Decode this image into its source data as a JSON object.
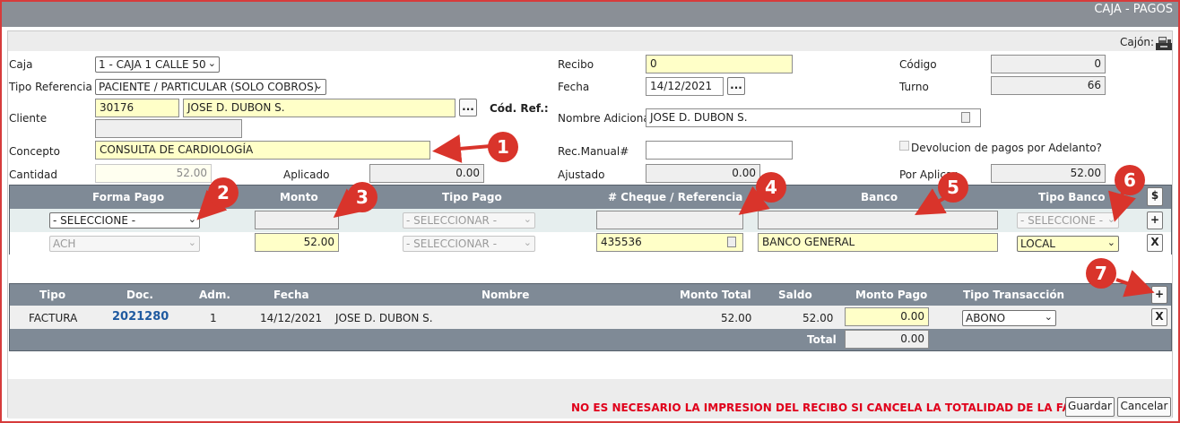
{
  "window": {
    "title": "CAJA - PAGOS"
  },
  "cajon_label": "Cajón:",
  "form": {
    "caja": {
      "label": "Caja",
      "value": "1 - CAJA 1 CALLE 50"
    },
    "tipo_referencia": {
      "label": "Tipo Referencia",
      "value": "PACIENTE / PARTICULAR (SOLO COBROS)"
    },
    "cliente": {
      "label": "Cliente",
      "code": "30176",
      "name": "JOSE D. DUBON S.",
      "extra": ""
    },
    "cod_ref": {
      "label": "Cód. Ref.:"
    },
    "concepto": {
      "label": "Concepto",
      "value": "CONSULTA DE CARDIOLOGÍA"
    },
    "cantidad": {
      "label": "Cantidad",
      "value": "52.00"
    },
    "aplicado": {
      "label": "Aplicado",
      "value": "0.00"
    },
    "recibo": {
      "label": "Recibo",
      "value": "0"
    },
    "fecha": {
      "label": "Fecha",
      "value": "14/12/2021"
    },
    "nombre_adicional": {
      "label": "Nombre Adicional",
      "value": "JOSE D. DUBON S."
    },
    "rec_manual": {
      "label": "Rec.Manual#",
      "value": ""
    },
    "ajustado": {
      "label": "Ajustado",
      "value": "0.00"
    },
    "codigo": {
      "label": "Código",
      "value": "0"
    },
    "turno": {
      "label": "Turno",
      "value": "66"
    },
    "devolucion": {
      "label": "Devolucion de pagos por Adelanto?"
    },
    "por_aplicar": {
      "label": "Por Aplicar",
      "value": "52.00"
    },
    "ellipsis": "..."
  },
  "payments": {
    "headers": [
      "Forma Pago",
      "Monto",
      "Tipo Pago",
      "# Cheque / Referencia",
      "Banco",
      "Tipo Banco"
    ],
    "dollar_button": "$",
    "add_button": "+",
    "remove_button": "X",
    "new_row": {
      "forma_pago": "- SELECCIONE -",
      "monto": "",
      "tipo_pago": "- SELECCIONAR -",
      "referencia": "",
      "banco": "",
      "tipo_banco": "- SELECCIONE -"
    },
    "row": {
      "forma_pago": "ACH",
      "monto": "52.00",
      "tipo_pago": "- SELECCIONAR -",
      "referencia": "435536",
      "banco": "BANCO GENERAL",
      "tipo_banco": "LOCAL"
    }
  },
  "documents": {
    "headers": [
      "Tipo",
      "Doc.",
      "Adm.",
      "Fecha",
      "Nombre",
      "Monto Total",
      "Saldo",
      "Monto Pago",
      "Tipo Transacción"
    ],
    "add_button": "+",
    "remove_button": "X",
    "row": {
      "tipo": "FACTURA",
      "doc": "2021280",
      "adm": "1",
      "fecha": "14/12/2021",
      "nombre": "JOSE D. DUBON S.",
      "monto_total": "52.00",
      "saldo": "52.00",
      "monto_pago": "0.00",
      "tipo_transaccion": "ABONO"
    },
    "total_label": "Total",
    "total_value": "0.00"
  },
  "footer": {
    "warning": "NO ES NECESARIO LA IMPRESION DEL RECIBO SI CANCELA LA TOTALIDAD DE LA FACTURA",
    "guardar": "Guardar",
    "cancelar": "Cancelar"
  },
  "callouts": [
    "1",
    "2",
    "3",
    "4",
    "5",
    "6",
    "7"
  ],
  "colors": {
    "callout": "#d9342b",
    "header": "#7f8a96",
    "title": "#8a8f96",
    "warning": "#e0001b"
  }
}
